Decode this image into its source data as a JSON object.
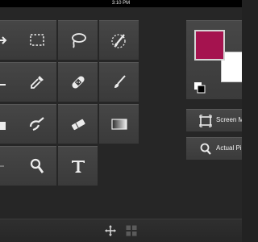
{
  "status_bar": {
    "time": "3:10 PM"
  },
  "tools": [
    {
      "name": "arrow-icon"
    },
    {
      "name": "rect-marquee-icon"
    },
    {
      "name": "lasso-icon"
    },
    {
      "name": "magic-brush-icon"
    },
    {
      "name": "pen-icon"
    },
    {
      "name": "eyedropper-icon"
    },
    {
      "name": "healing-bandage-icon"
    },
    {
      "name": "brush-icon"
    },
    {
      "name": "bucket-icon"
    },
    {
      "name": "smudge-icon"
    },
    {
      "name": "eraser-icon"
    },
    {
      "name": "gradient-icon"
    },
    {
      "name": "hand-icon"
    },
    {
      "name": "zoom-icon"
    },
    {
      "name": "text-icon"
    }
  ],
  "colors": {
    "foreground": "#a5134f",
    "background": "#ffffff",
    "panel": "#262626",
    "tool": "#414141"
  },
  "actions": {
    "screen_mode_label": "Screen M",
    "actual_pixels_label": "Actual Pi"
  },
  "bottom_bar": {
    "move_icon": "move-icon",
    "grid_icon": "grid-icon"
  }
}
